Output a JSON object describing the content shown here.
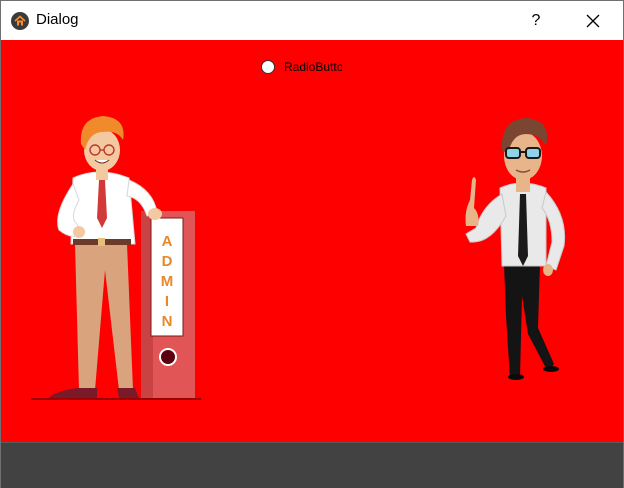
{
  "window": {
    "title": "Dialog",
    "help_label": "?",
    "close_icon": "close-icon",
    "app_icon": "home-icon"
  },
  "content": {
    "background": "#ff0000",
    "radio": {
      "label": "RadioButton",
      "checked": false
    },
    "left_illustration": {
      "folder_text": "ADMIN"
    }
  },
  "footer": {
    "background": "#424242"
  }
}
